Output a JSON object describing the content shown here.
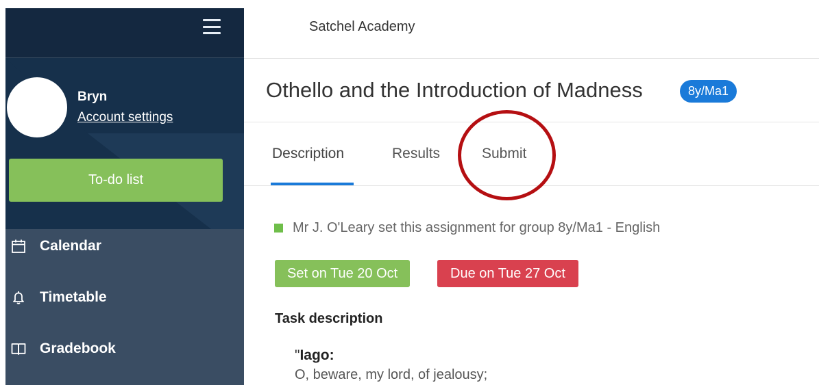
{
  "header": {
    "school_name": "Satchel Academy"
  },
  "sidebar": {
    "user_name": "Bryn",
    "account_link": "Account settings",
    "todo_label": "To-do list",
    "nav_items": [
      {
        "label": "Calendar",
        "icon": "calendar-icon"
      },
      {
        "label": "Timetable",
        "icon": "bell-icon"
      },
      {
        "label": "Gradebook",
        "icon": "book-icon"
      }
    ]
  },
  "assignment": {
    "title": "Othello and the Introduction of Madness",
    "group_badge": "8y/Ma1",
    "tabs": [
      {
        "label": "Description",
        "active": true
      },
      {
        "label": "Results",
        "active": false
      },
      {
        "label": "Submit",
        "active": false,
        "annotated": true
      }
    ],
    "setter_text": "Mr J. O'Leary set this assignment for group 8y/Ma1 - English",
    "set_on": "Set on Tue 20 Oct",
    "due_on": "Due on Tue 27 Oct",
    "task_heading": "Task description",
    "quote_open": "\"",
    "quote_speaker": "Iago:",
    "quote_line": "O, beware, my lord, of jealousy;"
  },
  "colors": {
    "sidebar_dark": "#142840",
    "sidebar_profile": "#16304b",
    "sidebar_nav": "#3a4d63",
    "accent_blue": "#1a7ad9",
    "green": "#86c05a",
    "red": "#d9414f",
    "annotation_red": "#b50f12"
  }
}
